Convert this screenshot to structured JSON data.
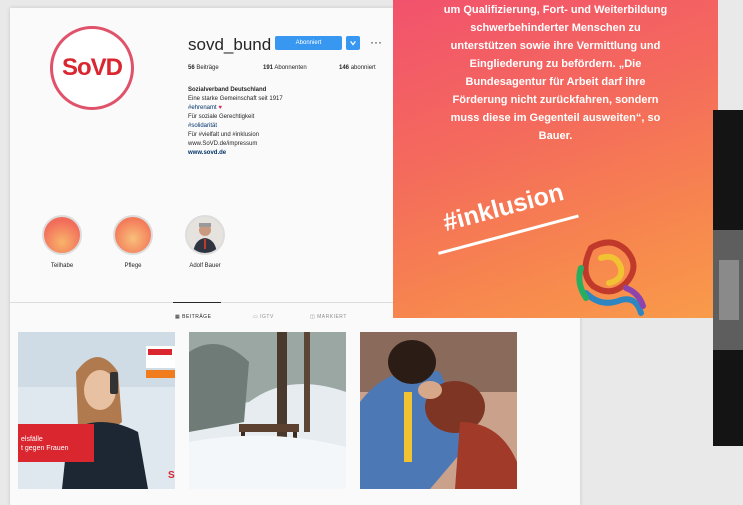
{
  "profile": {
    "username": "sovd_bund",
    "logo_text": "SoVD",
    "follow_label": "Abonniert",
    "more_label": "···",
    "stats": [
      {
        "count": "56",
        "label": "Beiträge"
      },
      {
        "count": "191",
        "label": "Abonnenten"
      },
      {
        "count": "146",
        "label": "abonniert"
      }
    ],
    "bio": {
      "name": "Sozialverband Deutschland",
      "line1": "Eine starke Gemeinschaft seit 1917",
      "line2": "#ehrenamt",
      "line3": "Für soziale Gerechtigkeit",
      "line4": "#solidarität",
      "line5": "Für #vielfalt und #inklusion",
      "line6": "www.SoVD.de/impressum",
      "link": "www.sovd.de"
    },
    "highlights": [
      {
        "label": "Teilhabe",
        "color": "#f47a5a"
      },
      {
        "label": "Pflege",
        "color": "#f5845a"
      },
      {
        "label": "Adolf Bauer",
        "color": "#d8d4d0"
      }
    ],
    "tabs": [
      "BEITRÄGE",
      "IGTV",
      "MARKIERT"
    ]
  },
  "story": {
    "lines": [
      "um Qualifizierung, Fort- und Weiterbildung",
      "schwerbehinderter Menschen zu",
      "unterstützen sowie ihre Vermittlung und",
      "Eingliederung zu befördern. „Die",
      "Bundesagentur für Arbeit darf ihre",
      "Förderung nicht zurückfahren, sondern",
      "muss diese im Gegenteil ausweiten“, so",
      "Bauer."
    ],
    "hashtag": "#inklusion"
  },
  "posts": [
    {
      "caption_line1": "elsfälle",
      "caption_line2": "t gegen Frauen"
    }
  ],
  "colors": {
    "accent": "#3897f0",
    "brand_red": "#d9262f",
    "story_start": "#f2526d",
    "story_end": "#f99b4a"
  }
}
